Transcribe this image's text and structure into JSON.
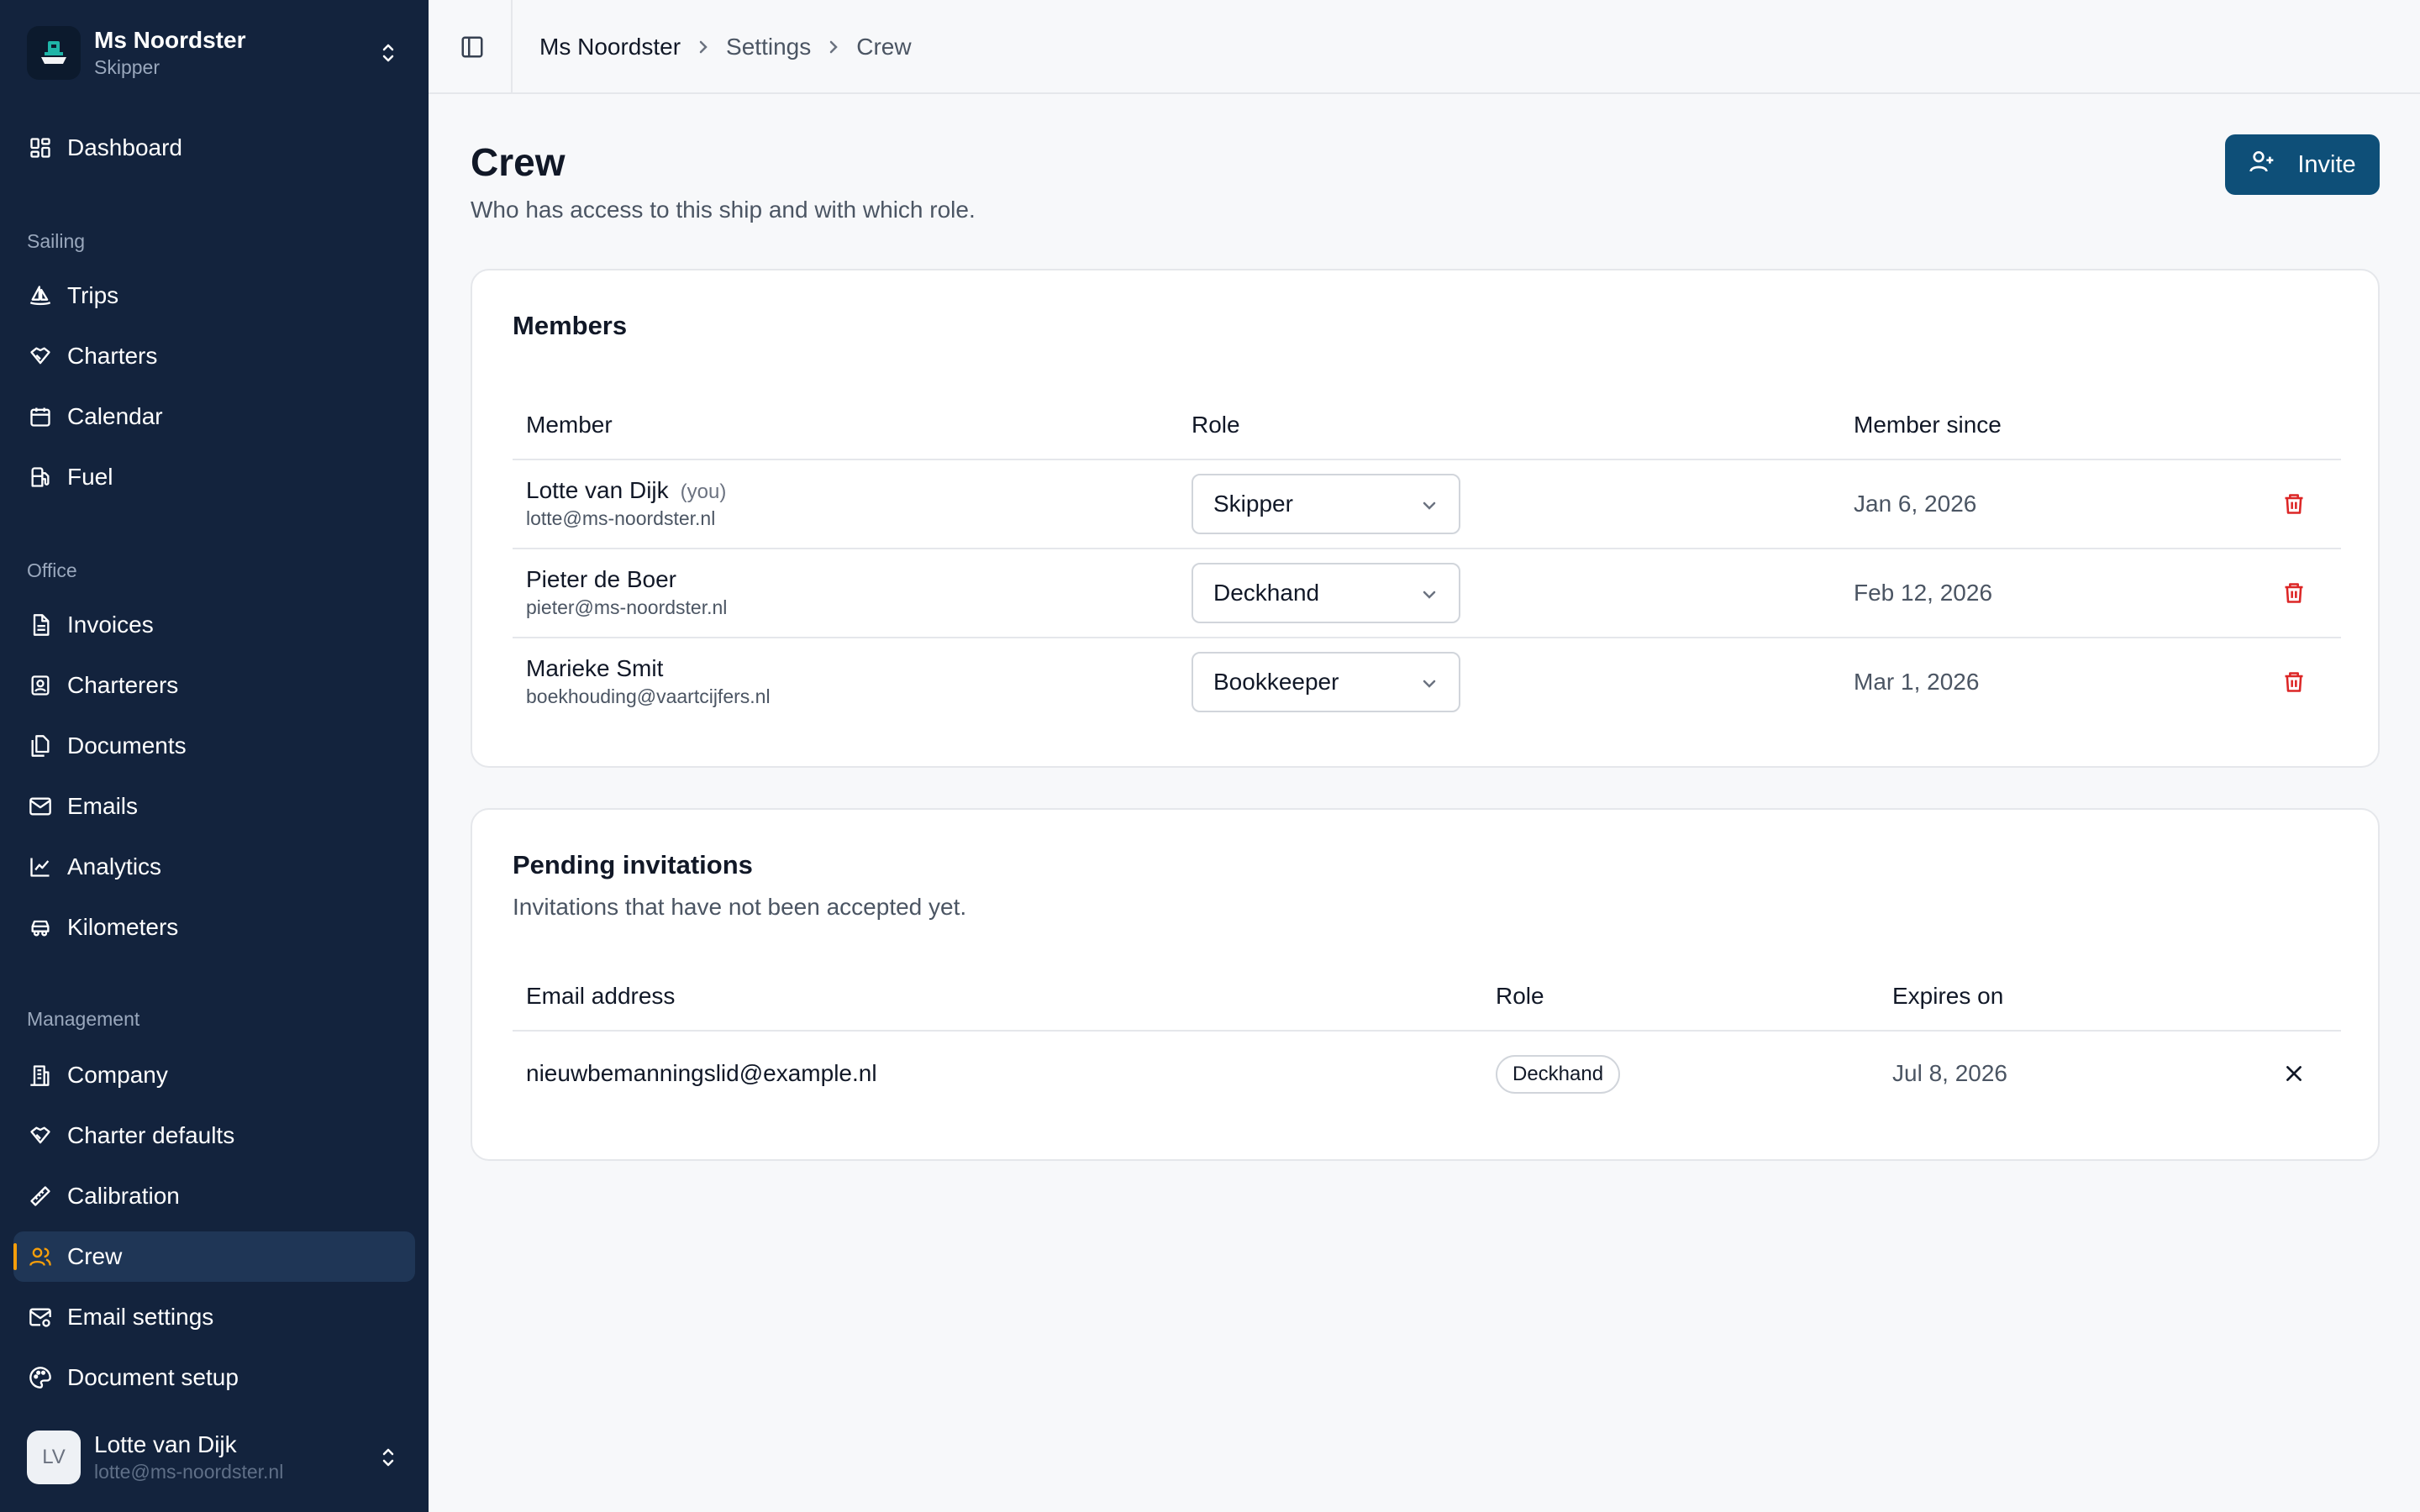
{
  "ship": {
    "name": "Ms Noordster",
    "role": "Skipper"
  },
  "nav": {
    "dashboard": "Dashboard",
    "sections": {
      "sailing": "Sailing",
      "office": "Office",
      "management": "Management"
    },
    "sailing": [
      "Trips",
      "Charters",
      "Calendar",
      "Fuel"
    ],
    "office": [
      "Invoices",
      "Charterers",
      "Documents",
      "Emails",
      "Analytics",
      "Kilometers"
    ],
    "management": [
      "Company",
      "Charter defaults",
      "Calibration",
      "Crew",
      "Email settings",
      "Document setup"
    ],
    "active": "Crew"
  },
  "user": {
    "initials": "LV",
    "name": "Lotte van Dijk",
    "email": "lotte@ms-noordster.nl"
  },
  "breadcrumb": [
    "Ms Noordster",
    "Settings",
    "Crew"
  ],
  "page": {
    "title": "Crew",
    "subtitle": "Who has access to this ship and with which role.",
    "invite_label": "Invite"
  },
  "members": {
    "title": "Members",
    "columns": {
      "member": "Member",
      "role": "Role",
      "since": "Member since"
    },
    "rows": [
      {
        "name": "Lotte van Dijk",
        "you": "(you)",
        "email": "lotte@ms-noordster.nl",
        "role": "Skipper",
        "since": "Jan 6, 2026"
      },
      {
        "name": "Pieter de Boer",
        "email": "pieter@ms-noordster.nl",
        "role": "Deckhand",
        "since": "Feb 12, 2026"
      },
      {
        "name": "Marieke Smit",
        "email": "boekhouding@vaartcijfers.nl",
        "role": "Bookkeeper",
        "since": "Mar 1, 2026"
      }
    ]
  },
  "invitations": {
    "title": "Pending invitations",
    "description": "Invitations that have not been accepted yet.",
    "columns": {
      "email": "Email address",
      "role": "Role",
      "expires": "Expires on"
    },
    "rows": [
      {
        "email": "nieuwbemanningslid@example.nl",
        "role": "Deckhand",
        "expires": "Jul 8, 2026"
      }
    ]
  },
  "colors": {
    "sidebar": "#13233d",
    "accent": "#0e4f78",
    "danger": "#dc2626",
    "active_marker": "#f59e0b"
  }
}
